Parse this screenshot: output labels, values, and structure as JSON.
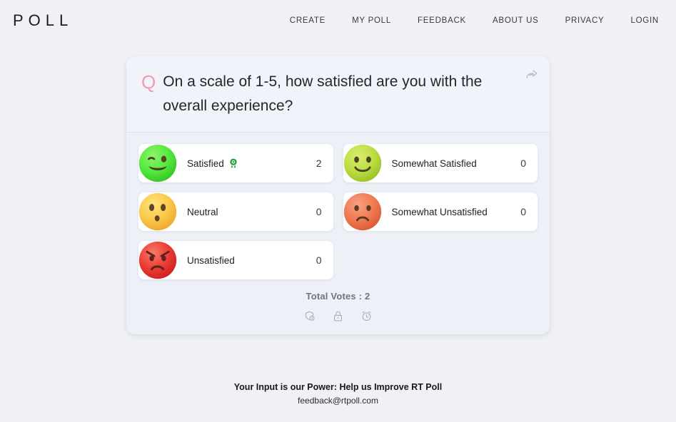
{
  "header": {
    "logo": "POLL",
    "nav": [
      {
        "label": "CREATE",
        "name": "nav-create"
      },
      {
        "label": "MY POLL",
        "name": "nav-my-poll"
      },
      {
        "label": "FEEDBACK",
        "name": "nav-feedback"
      },
      {
        "label": "ABOUT US",
        "name": "nav-about-us"
      },
      {
        "label": "PRIVACY",
        "name": "nav-privacy"
      },
      {
        "label": "LOGIN",
        "name": "nav-login"
      }
    ]
  },
  "poll": {
    "q_marker": "Q",
    "question": "On a scale of 1-5, how satisfied are you with the overall experience?",
    "share_icon": "share-arrow-icon",
    "options": [
      {
        "label": "Satisfied",
        "count": "2",
        "emoji": "winking-green-face",
        "winner_badge": "award-rosette-icon"
      },
      {
        "label": "Somewhat Satisfied",
        "count": "0",
        "emoji": "smiling-yellow-green-face",
        "winner_badge": ""
      },
      {
        "label": "Neutral",
        "count": "0",
        "emoji": "surprised-yellow-face",
        "winner_badge": ""
      },
      {
        "label": "Somewhat Unsatisfied",
        "count": "0",
        "emoji": "frowning-orange-face",
        "winner_badge": ""
      },
      {
        "label": "Unsatisfied",
        "count": "0",
        "emoji": "angry-red-face",
        "winner_badge": ""
      }
    ],
    "total_votes": "Total Votes : 2",
    "footer_icons": [
      {
        "name": "hidden-results-clock-icon"
      },
      {
        "name": "lock-icon"
      },
      {
        "name": "alarm-clock-icon"
      }
    ]
  },
  "footer": {
    "title": "Your Input is our Power: Help us Improve RT Poll",
    "email": "feedback@rtpoll.com"
  },
  "colors": {
    "page_background": "#eff1f4",
    "card_background": "#eef0f8",
    "card_header_background": "#f1f3fa",
    "option_background": "#ffffff",
    "q_marker": "#f39ab0",
    "total_votes_text": "#6f7384",
    "emoji_satisfied": "#4ede3c",
    "emoji_somewhat_satisfied": "#b4db3d",
    "emoji_neutral": "#f7c94b",
    "emoji_somewhat_unsatisfied": "#ef7a52",
    "emoji_unsatisfied": "#ec3b33"
  }
}
